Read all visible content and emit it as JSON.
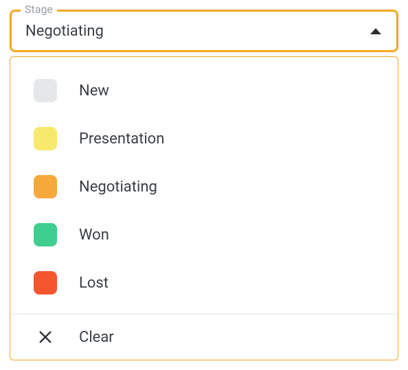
{
  "field": {
    "label": "Stage",
    "selected": "Negotiating"
  },
  "options": [
    {
      "label": "New",
      "color": "#e5e7e9"
    },
    {
      "label": "Presentation",
      "color": "#f7e96b"
    },
    {
      "label": "Negotiating",
      "color": "#f5a93b"
    },
    {
      "label": "Won",
      "color": "#3ecf8e"
    },
    {
      "label": "Lost",
      "color": "#f4562e"
    }
  ],
  "clear": {
    "label": "Clear"
  }
}
